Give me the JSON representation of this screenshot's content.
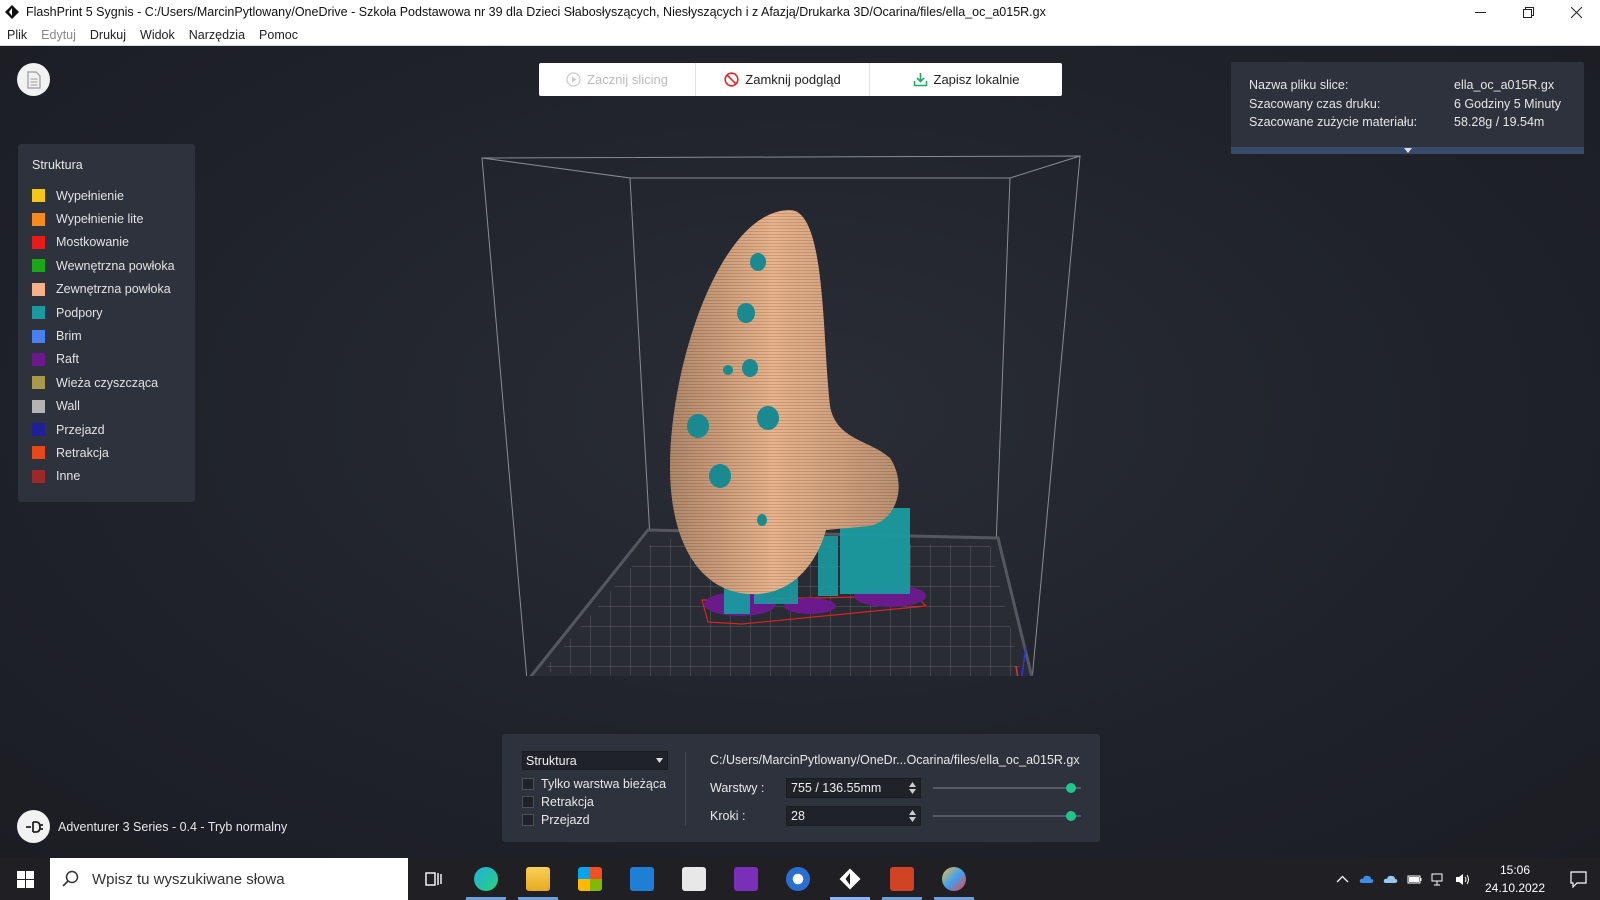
{
  "window": {
    "title": "FlashPrint 5 Sygnis - C:/Users/MarcinPytlowany/OneDrive - Szkoła Podstawowa nr 39 dla Dzieci Słabosłyszących, Niesłyszących i z Afazją/Drukarka 3D/Ocarina/files/ella_oc_a015R.gx"
  },
  "menu": {
    "items": [
      "Plik",
      "Edytuj",
      "Drukuj",
      "Widok",
      "Narzędzia",
      "Pomoc"
    ]
  },
  "toolbar": {
    "start_label": "Zacznij slicing",
    "close_label": "Zamknij podgląd",
    "save_label": "Zapisz lokalnie"
  },
  "legend": {
    "title": "Struktura",
    "items": [
      {
        "label": "Wypełnienie",
        "color": "#f5c518"
      },
      {
        "label": "Wypełnienie lite",
        "color": "#f58a1f"
      },
      {
        "label": "Mostkowanie",
        "color": "#e81a1a"
      },
      {
        "label": "Wewnętrzna powłoka",
        "color": "#1aa81a"
      },
      {
        "label": "Zewnętrzna powłoka",
        "color": "#f5b28a"
      },
      {
        "label": "Podpory",
        "color": "#1a9aa0"
      },
      {
        "label": "Brim",
        "color": "#4a7ff0"
      },
      {
        "label": "Raft",
        "color": "#6a1a8a"
      },
      {
        "label": "Wieża czyszcząca",
        "color": "#a89a4a"
      },
      {
        "label": "Wall",
        "color": "#b4b4b4"
      },
      {
        "label": "Przejazd",
        "color": "#1f1f9a"
      },
      {
        "label": "Retrakcja",
        "color": "#e8471a"
      },
      {
        "label": "Inne",
        "color": "#9a2a2a"
      }
    ]
  },
  "info": {
    "file_label": "Nazwa pliku slice:",
    "file_value": "ella_oc_a015R.gx",
    "time_label": "Szacowany czas druku:",
    "time_value": "6 Godziny 5 Minuty",
    "material_label": "Szacowane zużycie materiału:",
    "material_value": "58.28g / 19.54m"
  },
  "bottom": {
    "view_select": "Struktura",
    "chk_current_layer": "Tylko warstwa bieżąca",
    "chk_retraction": "Retrakcja",
    "chk_travel": "Przejazd",
    "path": "C:/Users/MarcinPytlowany/OneDr...Ocarina/files/ella_oc_a015R.gx",
    "layers_label": "Warstwy :",
    "layers_value": "755 / 136.55mm",
    "layers_fraction": 1.0,
    "steps_label": "Kroki :",
    "steps_value": "28",
    "steps_fraction": 1.0
  },
  "printer": {
    "label": "Adventurer 3 Series - 0.4 - Tryb normalny"
  },
  "taskbar": {
    "search_placeholder": "Wpisz tu wyszukiwane słowa",
    "time": "15:06",
    "date": "24.10.2022"
  }
}
